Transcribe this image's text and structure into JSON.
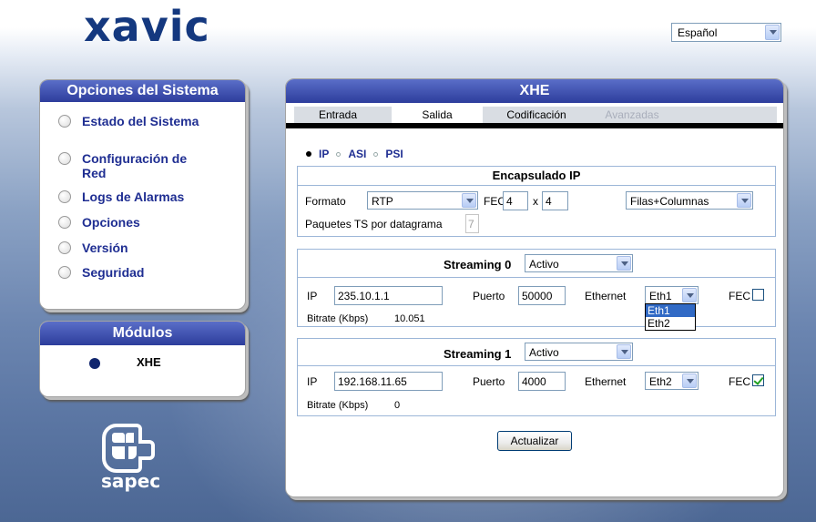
{
  "brand": {
    "logo": "xavic",
    "footer_logo": "sapec"
  },
  "language": {
    "selected": "Español"
  },
  "system_panel": {
    "title": "Opciones del Sistema",
    "items": [
      {
        "label": "Estado del Sistema"
      },
      {
        "label": "Configuración de Red"
      },
      {
        "label": "Logs de Alarmas"
      },
      {
        "label": "Opciones"
      },
      {
        "label": "Versión"
      },
      {
        "label": "Seguridad"
      }
    ]
  },
  "modules_panel": {
    "title": "Módulos",
    "items": [
      {
        "label": "XHE"
      }
    ]
  },
  "main": {
    "title": "XHE",
    "tabs": [
      {
        "label": "Entrada",
        "state": "normal"
      },
      {
        "label": "Salida",
        "state": "active"
      },
      {
        "label": "Codificación",
        "state": "normal"
      },
      {
        "label": "Avanzadas",
        "state": "disabled"
      }
    ],
    "output_type": {
      "options": [
        "IP",
        "ASI",
        "PSI"
      ],
      "selected": "IP"
    },
    "encapsulation": {
      "title": "Encapsulado IP",
      "format_label": "Formato",
      "format_value": "RTP",
      "fec_label": "FEC",
      "fec_rows": "4",
      "fec_x": "x",
      "fec_cols": "4",
      "fec_mode": "Filas+Columnas",
      "packets_label": "Paquetes TS por datagrama",
      "packets_value": "7"
    },
    "streaming0": {
      "title": "Streaming 0",
      "status": "Activo",
      "ip_label": "IP",
      "ip": "235.10.1.1",
      "port_label": "Puerto",
      "port": "50000",
      "ethernet_label": "Ethernet",
      "ethernet": "Eth1",
      "ethernet_options": [
        "Eth1",
        "Eth2"
      ],
      "fec_label": "FEC",
      "fec_checked": false,
      "bitrate_label": "Bitrate (Kbps)",
      "bitrate": "10.051"
    },
    "streaming1": {
      "title": "Streaming 1",
      "status": "Activo",
      "ip_label": "IP",
      "ip": "192.168.11.65",
      "port_label": "Puerto",
      "port": "4000",
      "ethernet_label": "Ethernet",
      "ethernet": "Eth2",
      "fec_label": "FEC",
      "fec_checked": true,
      "bitrate_label": "Bitrate (Kbps)",
      "bitrate": "0"
    },
    "update_button": "Actualizar"
  },
  "colors": {
    "header_gradient_top": "#5a6ec8",
    "header_gradient_bottom": "#2d3d9c",
    "menu_text": "#1f2e92",
    "logo": "#14387f",
    "checkbox_check": "#21a121",
    "dropdown_selected": "#316ac5"
  },
  "icons": {
    "combo": "chevron-down-icon",
    "module": "status-dot-icon",
    "sapec": "sapec-logo-icon"
  }
}
